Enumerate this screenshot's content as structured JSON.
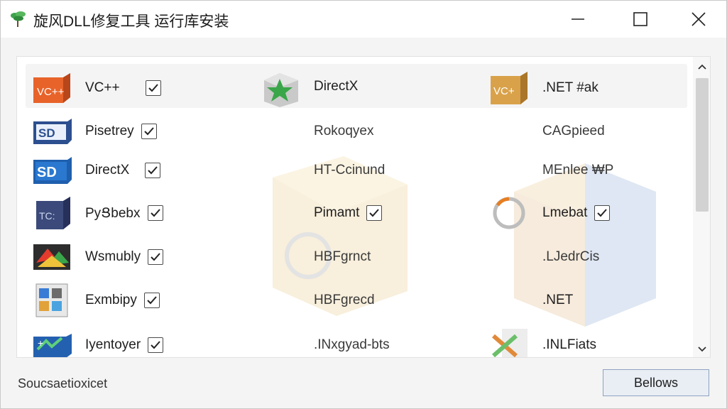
{
  "window": {
    "title": "旋风DLL修复工具 运行库安装",
    "app_icon": "tree-icon",
    "controls": [
      "minimize-icon",
      "maximize-icon",
      "close-icon"
    ]
  },
  "list": {
    "columns": [
      [
        {
          "label": "VC++",
          "icon": "vc-box-icon",
          "checked": true
        },
        {
          "label": "Pisetrey",
          "icon": "directx-sd-icon",
          "checked": true
        },
        {
          "label": "DirectX",
          "icon": "sd-icon",
          "checked": true
        },
        {
          "label": "PyՑbebx",
          "icon": "cube-tc-icon",
          "checked": true
        },
        {
          "label": "Wsmubly",
          "icon": "colorful-card-icon",
          "checked": true
        },
        {
          "label": "Exmbipy",
          "icon": "multi-box-icon",
          "checked": true
        },
        {
          "label": "Iyentoyer",
          "icon": "blue-battery-icon",
          "checked": true
        }
      ],
      [
        {
          "label": "DirectX",
          "icon": "green-star-box-icon",
          "checked": false
        },
        {
          "label": "Rokoqyex",
          "icon": "",
          "checked": false
        },
        {
          "label": "HT-Ccinund",
          "icon": "",
          "checked": false
        },
        {
          "label": "Pimamt",
          "icon": "",
          "checked": true
        },
        {
          "label": "HBFgrnct",
          "icon": "",
          "checked": false
        },
        {
          "label": "HBFgrecd",
          "icon": "",
          "checked": false
        },
        {
          "label": ".INxgyad-bts",
          "icon": "",
          "checked": false
        }
      ],
      [
        {
          "label": ".NET #ak",
          "icon": "vc-gold-box-icon",
          "checked": false
        },
        {
          "label": "CAGpieed",
          "icon": "",
          "checked": false
        },
        {
          "label": "MEnlee ₩P",
          "icon": "",
          "checked": false
        },
        {
          "label": "Lmebat",
          "icon": "ring-icon",
          "checked": true
        },
        {
          "label": ".LJedrCis",
          "icon": "",
          "checked": false
        },
        {
          "label": ".NET",
          "icon": "",
          "checked": false
        },
        {
          "label": ".INLFiats",
          "icon": "x-arrow-icon",
          "checked": false
        }
      ]
    ]
  },
  "footer": {
    "status": "Soucsaetioxicet",
    "button": "Bellows"
  },
  "colors": {
    "accent": "#3d7dc6",
    "button_border": "#8ea2c0",
    "scroll_thumb": "#d2d2d2"
  }
}
